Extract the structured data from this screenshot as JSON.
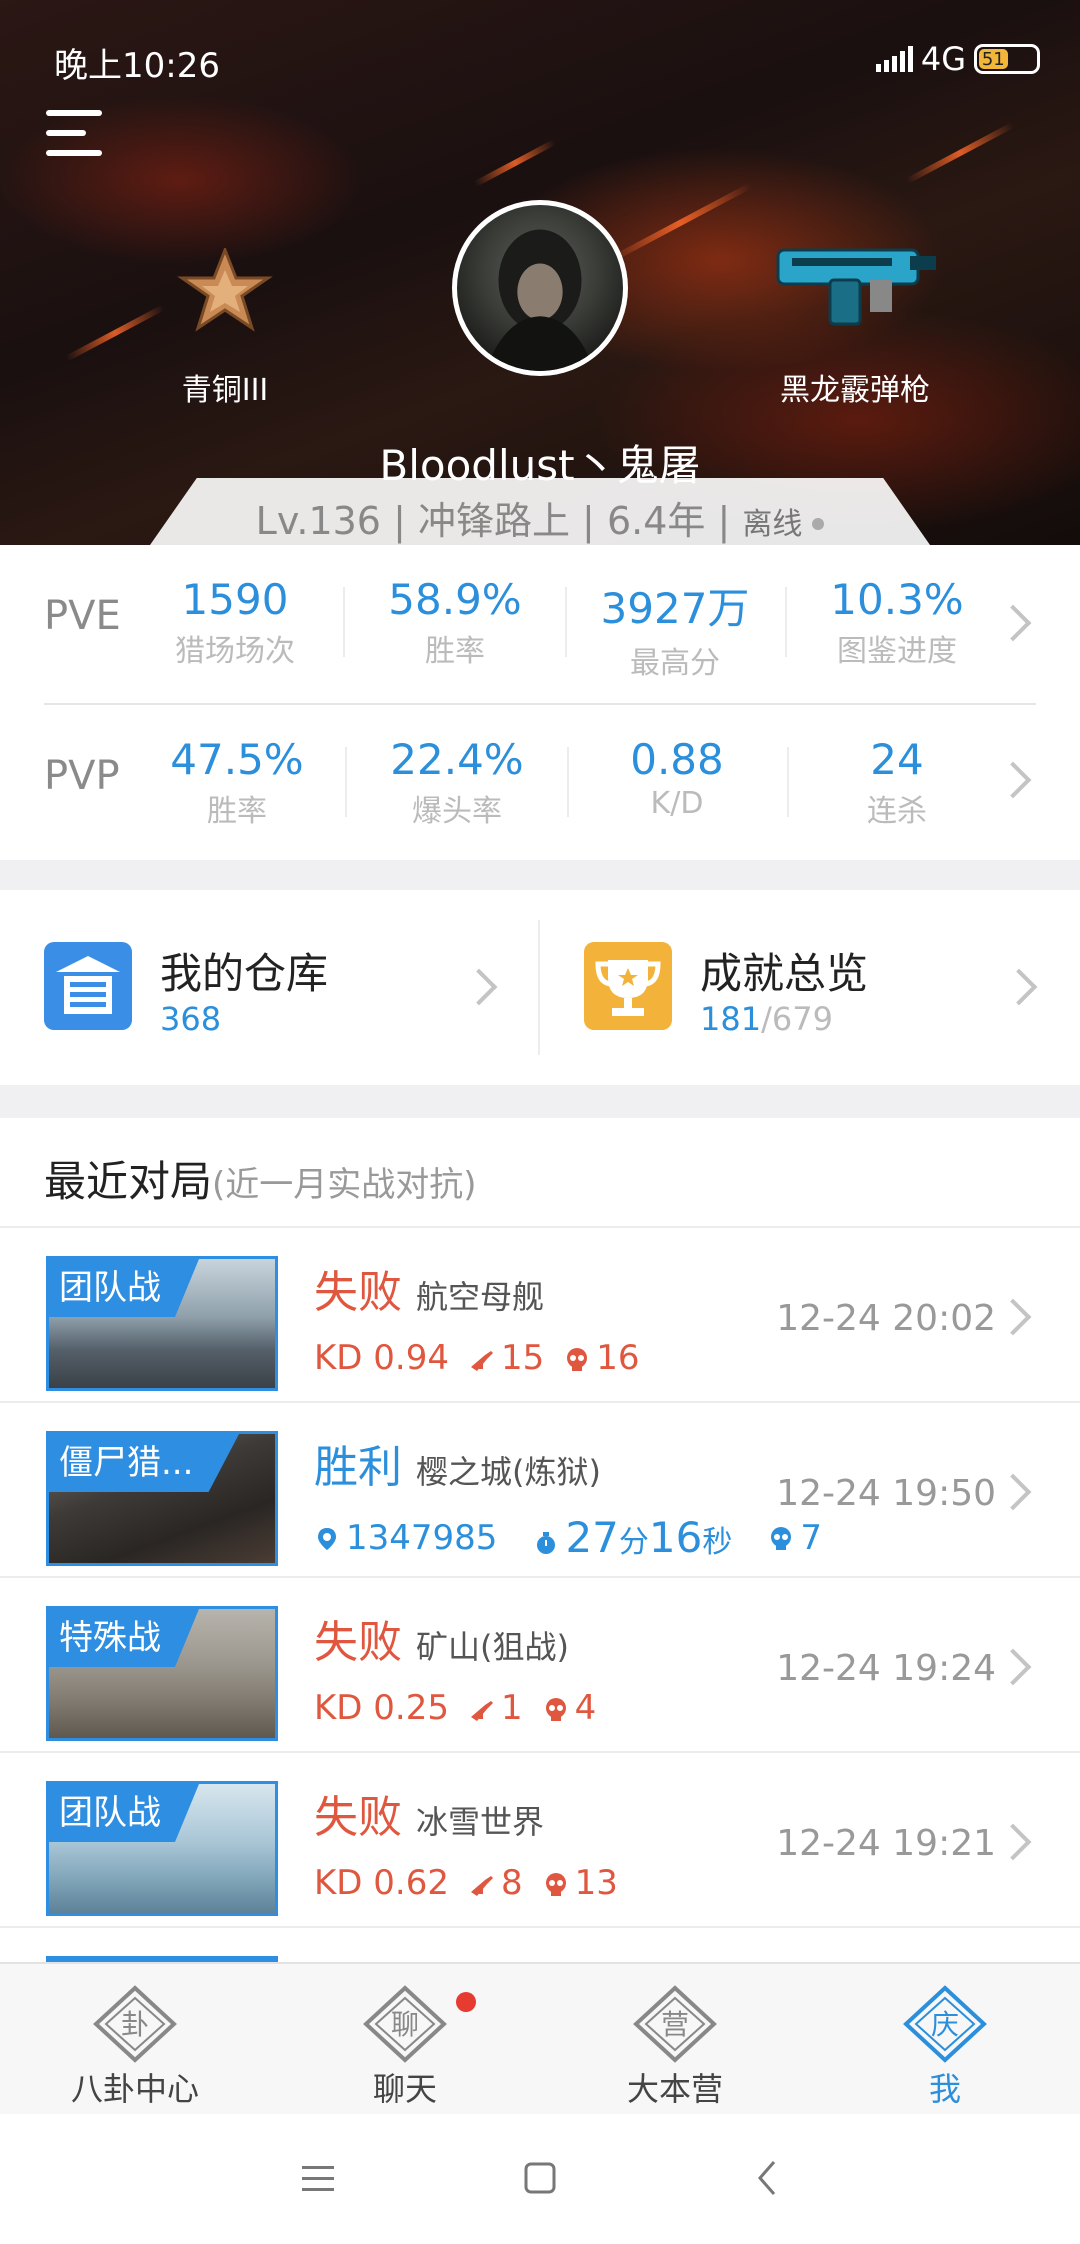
{
  "status_bar": {
    "time": "晚上10:26",
    "network": "4G",
    "battery": "51",
    "battery_level": 0.51
  },
  "profile": {
    "rank": "青铜III",
    "weapon": "黑龙霰弹枪",
    "name": "Bloodlust丶鬼屠",
    "level": "Lv.136",
    "title": "冲锋路上",
    "years": "6.4年",
    "status": "离线"
  },
  "pve": {
    "label": "PVE",
    "stats": [
      {
        "value": "1590",
        "name": "猎场场次"
      },
      {
        "value": "58.9%",
        "name": "胜率"
      },
      {
        "value": "3927万",
        "name": "最高分"
      },
      {
        "value": "10.3%",
        "name": "图鉴进度"
      }
    ]
  },
  "pvp": {
    "label": "PVP",
    "stats": [
      {
        "value": "47.5%",
        "name": "胜率"
      },
      {
        "value": "22.4%",
        "name": "爆头率"
      },
      {
        "value": "0.88",
        "name": "K/D"
      },
      {
        "value": "24",
        "name": "连杀"
      }
    ]
  },
  "shortcuts": {
    "warehouse": {
      "title": "我的仓库",
      "count": "368"
    },
    "achievement": {
      "title": "成就总览",
      "count": "181",
      "total": "/679"
    }
  },
  "recent": {
    "title": "最近对局",
    "subtitle": "(近一月实战对抗)",
    "matches": [
      {
        "mode": "团队战",
        "result": "失败",
        "map": "航空母舰",
        "kd": "KD 0.94",
        "kills": "15",
        "deaths": "16",
        "time": "12-24 20:02"
      },
      {
        "mode": "僵尸猎...",
        "result": "胜利",
        "map": "樱之城(炼狱)",
        "score": "1347985",
        "duration_min": "27",
        "min_unit": "分",
        "duration_sec": "16",
        "sec_unit": "秒",
        "deaths": "7",
        "time": "12-24 19:50"
      },
      {
        "mode": "特殊战",
        "result": "失败",
        "map": "矿山(狙战)",
        "kd": "KD 0.25",
        "kills": "1",
        "deaths": "4",
        "time": "12-24 19:24"
      },
      {
        "mode": "团队战",
        "result": "失败",
        "map": "冰雪世界",
        "kd": "KD 0.62",
        "kills": "8",
        "deaths": "13",
        "time": "12-24 19:21"
      }
    ]
  },
  "tabs": [
    {
      "label": "八卦中心",
      "glyph": "卦"
    },
    {
      "label": "聊天",
      "glyph": "聊"
    },
    {
      "label": "大本营",
      "glyph": "营"
    },
    {
      "label": "我",
      "glyph": "庆"
    }
  ],
  "colors": {
    "accent": "#2c8fdc",
    "lose": "#e0573f",
    "badge": "#e63b30"
  }
}
